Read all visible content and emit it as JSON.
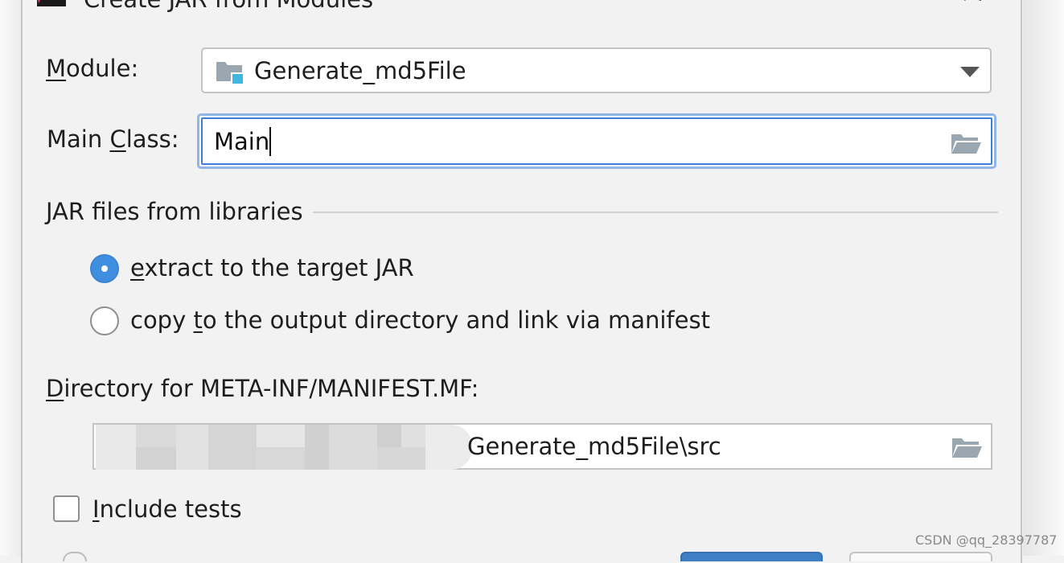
{
  "dialog": {
    "title": "Create JAR from Modules"
  },
  "module": {
    "label": "Module:",
    "value": "Generate_md5File"
  },
  "main_class": {
    "label": "Main Class:",
    "value": "Main"
  },
  "libraries": {
    "group_label": "JAR files from libraries",
    "options": [
      {
        "label": "extract to the target JAR",
        "selected": true
      },
      {
        "label": "copy to the output directory and link via manifest",
        "selected": false
      }
    ]
  },
  "manifest_dir": {
    "label": "Directory for META-INF/MANIFEST.MF:",
    "value_visible": "Generate_md5File\\src"
  },
  "include_tests": {
    "label": "Include tests",
    "checked": false
  },
  "watermark": "CSDN @qq_28397787",
  "colors": {
    "accent": "#3f8ee0",
    "focus_border": "#3d7fd5",
    "dialog_bg": "#f2f2f2",
    "field_bg": "#ffffff"
  },
  "icons": [
    "intellij-logo-icon",
    "close-icon",
    "module-folder-icon",
    "chevron-down-icon",
    "folder-open-icon"
  ]
}
